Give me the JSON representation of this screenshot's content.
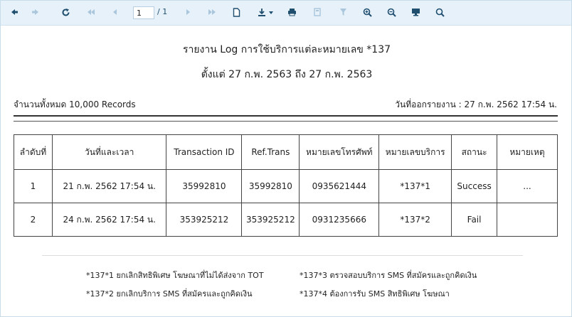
{
  "toolbar": {
    "page_current": "1",
    "page_total": "/ 1",
    "icons": [
      "back-arrow-icon",
      "forward-arrow-icon",
      "refresh-icon",
      "first-page-icon",
      "previous-page-icon",
      "next-page-icon",
      "last-page-icon",
      "new-document-icon",
      "download-icon",
      "print-icon",
      "calculator-icon",
      "filter-icon",
      "zoom-in-icon",
      "zoom-out-icon",
      "monitor-icon",
      "search-icon"
    ]
  },
  "report": {
    "title": "รายงาน Log การใช้บริการแต่ละหมายเลข *137",
    "date_range": "ตั้งแต่ 27 ก.พ. 2563 ถึง 27 ก.พ. 2563",
    "total_records": "จำนวนทั้งหมด 10,000 Records",
    "issued_date": "วันที่ออกรายงาน : 27 ก.พ. 2562 17:54 น."
  },
  "table": {
    "headers": [
      "ลำดับที่",
      "วันที่และเวลา",
      "Transaction ID",
      "Ref.Trans",
      "หมายเลขโทรศัพท์",
      "หมายเลขบริการ",
      "สถานะ",
      "หมายเหตุ"
    ],
    "rows": [
      [
        "1",
        "21 ก.พ. 2562 17:54 น.",
        "35992810",
        "35992810",
        "0935621444",
        "*137*1",
        "Success",
        "..."
      ],
      [
        "2",
        "24 ก.พ. 2562 17:54 น.",
        "353925212",
        "353925212",
        "0931235666",
        "*137*2",
        "Fail",
        ""
      ]
    ]
  },
  "notes": {
    "n1": "*137*1 ยกเลิกสิทธิพิเศษ โฆษณาที่ไม่ได้ส่งจาก TOT",
    "n2": "*137*2 ยกเลิกบริการ SMS ที่สมัครและถูกคิดเงิน",
    "n3": "*137*3 ตรวจสอบบริการ SMS ที่สมัครและถูกคิดเงิน",
    "n4": "*137*4 ต้องการรับ SMS สิทธิพิเศษ โฆษณา"
  },
  "colors": {
    "toolbar_bg": "#e6f1f9",
    "icon": "#1f4e6f",
    "icon_disabled": "#a9c6dc"
  }
}
